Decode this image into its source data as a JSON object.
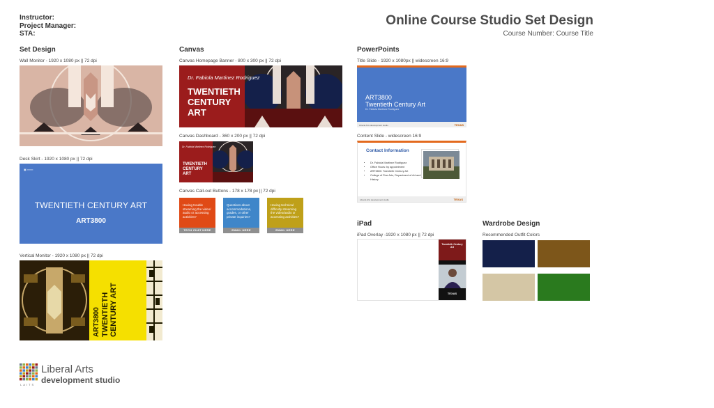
{
  "header": {
    "instructor_label": "Instructor:",
    "pm_label": "Project Manager:",
    "sta_label": "STA:",
    "title": "Online Course Studio Set Design",
    "subtitle": "Course Number: Course Title"
  },
  "set_design": {
    "heading": "Set Design",
    "wall_caption": "Wall Monitor - 1920 x 1080 px || 72 dpi",
    "desk_caption": "Desk Skirt - 1920 x 1080 px || 72 dpi",
    "desk_title": "TWENTIETH CENTURY ART",
    "desk_course": "ART3800",
    "vert_caption": "Vertical Monitor - 1920 x 1080 px || 72 dpi",
    "vert_course": "ART3800",
    "vert_title_1": "TWENTIETH",
    "vert_title_2": "CENTURY ART"
  },
  "canvas": {
    "heading": "Canvas",
    "banner_caption": "Canvas Homepage Banner - 800 x 300 px || 72 dpi",
    "instructor_name": "Dr. Fabiola Martinez Rodriguez",
    "banner_line1": "TWENTIETH",
    "banner_line2": "CENTURY",
    "banner_line3": "ART",
    "dash_caption": "Canvas Dashboard - 360 x 200 px || 72 dpi",
    "callout_caption": "Canvas Call-out Buttons - 178 x 178 px || 72 dpi",
    "buttons": [
      {
        "text": "Having trouble streaming the video/ audio or accessing activities?",
        "label": "TECH CHAT HERE"
      },
      {
        "text": "Questions about accommodations, grades, or other private inquiries?",
        "label": "EMAIL HERE"
      },
      {
        "text": "Having technical difficulty streaming the video/audio or accessing activities?",
        "label": "EMAIL HERE"
      }
    ]
  },
  "powerpoints": {
    "heading": "PowerPoints",
    "title_caption": "Title Slide - 1920 x 1080px || widescreen 16:9",
    "title_course": "ART3800",
    "title_name": "Twentieth Century Art",
    "title_instructor": "Dr. Fabiola Martinez Rodriguez",
    "content_caption": "Content Slide - widescreen 16:9",
    "content_heading": "Contact Information",
    "content_items": [
      "Dr. Fabiola Martinez Rodriguez",
      "Office Hours: by appointment",
      "ART3800: Twentieth Century Art",
      "College of Fine Arts, Department of Art and Art History"
    ],
    "footer_logo": "Liberal Arts development studio",
    "footer_texas": "TEXAS"
  },
  "ipad": {
    "heading": "iPad",
    "caption": "iPad Overlay -1920 x 1080 px || 72 dpi",
    "side_title": "Twentieth Century Art",
    "side_texas": "TEXAS"
  },
  "wardrobe": {
    "heading": "Wardrobe Design",
    "caption": "Recommended Outfit Colors",
    "colors": [
      "#14204a",
      "#7d561a",
      "#d4c6a5",
      "#2a7a1e"
    ]
  },
  "logo": {
    "line1": "Liberal Arts",
    "line2": "development studio",
    "acronym": "LAITS"
  },
  "colors": {
    "blue": "#4a78c8",
    "red": "#9b1c1c",
    "yellow": "#f5e000",
    "orange": "#e36a1e",
    "burnt_orange": "#bf5700"
  }
}
